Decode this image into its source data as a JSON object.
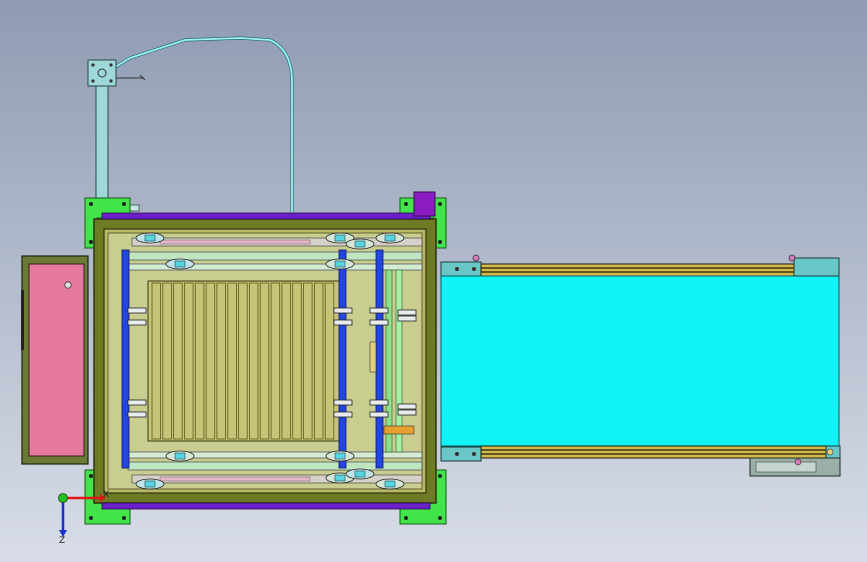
{
  "viewport": {
    "background_top": "#8f9bb3",
    "background_bottom": "#d8dde7"
  },
  "colors": {
    "frame_green": "#6f7a25",
    "frame_dark": "#2e3410",
    "bracket_green": "#43e34a",
    "purple": "#6b20c9",
    "blue_post": "#2446e0",
    "olive_fill": "#b8b866",
    "slat": "#c6c476",
    "slat_dark": "#5b5a20",
    "pink_panel": "#e6799f",
    "conveyor_cyan": "#10f3f7",
    "conveyor_frame": "#6ac7c8",
    "gold_rail": "#d3b94a",
    "cable": "#9cf3f5",
    "mount_plate": "#9ed8d8"
  },
  "triad": {
    "x_label": "X",
    "z_label": "Z",
    "x_color": "#e01818",
    "y_color": "#20c020",
    "z_color": "#1830d0"
  }
}
